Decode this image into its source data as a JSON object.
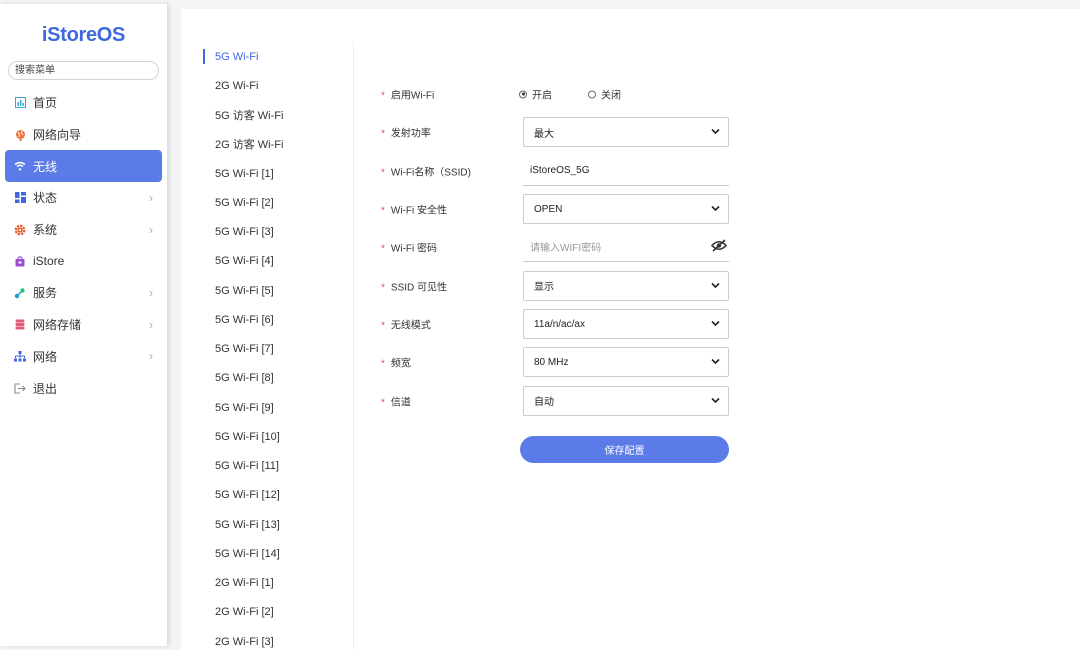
{
  "app": {
    "logo": "iStoreOS"
  },
  "sidebar": {
    "search_placeholder": "搜索菜单",
    "items": [
      {
        "label": "首页",
        "icon": "home-chart-icon",
        "has_arrow": false
      },
      {
        "label": "网络向导",
        "icon": "globe-icon",
        "has_arrow": false
      },
      {
        "label": "无线",
        "icon": "wifi-icon",
        "has_arrow": false,
        "active": true
      },
      {
        "label": "状态",
        "icon": "dashboard-icon",
        "has_arrow": true
      },
      {
        "label": "系统",
        "icon": "gear-icon",
        "has_arrow": true
      },
      {
        "label": "iStore",
        "icon": "store-bag-icon",
        "has_arrow": false
      },
      {
        "label": "服务",
        "icon": "services-icon",
        "has_arrow": true
      },
      {
        "label": "网络存储",
        "icon": "database-icon",
        "has_arrow": true
      },
      {
        "label": "网络",
        "icon": "network-tree-icon",
        "has_arrow": true
      },
      {
        "label": "退出",
        "icon": "logout-icon",
        "has_arrow": false
      }
    ]
  },
  "subnav": {
    "items": [
      "5G Wi-Fi",
      "2G Wi-Fi",
      "5G 访客 Wi-Fi",
      "2G 访客 Wi-Fi",
      "5G Wi-Fi [1]",
      "5G Wi-Fi [2]",
      "5G Wi-Fi [3]",
      "5G Wi-Fi [4]",
      "5G Wi-Fi [5]",
      "5G Wi-Fi [6]",
      "5G Wi-Fi [7]",
      "5G Wi-Fi [8]",
      "5G Wi-Fi [9]",
      "5G Wi-Fi [10]",
      "5G Wi-Fi [11]",
      "5G Wi-Fi [12]",
      "5G Wi-Fi [13]",
      "5G Wi-Fi [14]",
      "2G Wi-Fi [1]",
      "2G Wi-Fi [2]",
      "2G Wi-Fi [3]"
    ],
    "active_index": 0
  },
  "form": {
    "required_mark": "*",
    "enable": {
      "label": "启用Wi-Fi",
      "on_label": "开启",
      "off_label": "关闭",
      "value": "开启"
    },
    "tx_power": {
      "label": "发射功率",
      "value": "最大"
    },
    "ssid": {
      "label": "Wi-Fi名称（SSID)",
      "value": "iStoreOS_5G"
    },
    "security": {
      "label": "Wi-Fi 安全性",
      "value": "OPEN"
    },
    "password": {
      "label": "Wi-Fi 密码",
      "placeholder": "请输入WIFI密码"
    },
    "ssid_visibility": {
      "label": "SSID 可见性",
      "value": "显示"
    },
    "wireless_mode": {
      "label": "无线模式",
      "value": "11a/n/ac/ax"
    },
    "bandwidth": {
      "label": "频宽",
      "value": "80 MHz"
    },
    "channel": {
      "label": "信道",
      "value": "自动"
    },
    "save_label": "保存配置"
  },
  "colors": {
    "accent": "#5b7be8",
    "brand": "#3d68de",
    "required": "#e84e4e"
  }
}
